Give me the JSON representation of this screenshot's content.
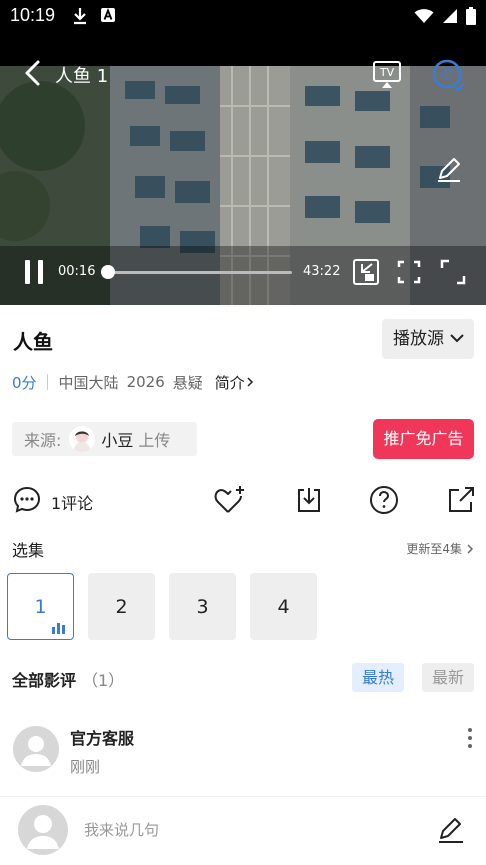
{
  "status_bar": {
    "time": "10:19"
  },
  "player": {
    "title": "人鱼 1",
    "tv_label": "TV",
    "speed_label": "倍",
    "current_time": "00:16",
    "total_time": "43:22",
    "progress": 0.006
  },
  "show": {
    "title": "人鱼",
    "source_label": "播放源",
    "score": "0分",
    "region": "中国大陆",
    "year": "2026",
    "genre": "悬疑",
    "intro_label": "简介"
  },
  "uploader": {
    "prefix": "来源:",
    "name": "小豆",
    "suffix": "上传"
  },
  "promo_label": "推广免广告",
  "actions": {
    "comment_count": "1评论"
  },
  "episodes": {
    "title": "选集",
    "update_text": "更新至4集",
    "items": [
      {
        "label": "1",
        "active": true
      },
      {
        "label": "2",
        "active": false
      },
      {
        "label": "3",
        "active": false
      },
      {
        "label": "4",
        "active": false
      }
    ]
  },
  "reviews": {
    "title": "全部影评",
    "count": "（1）",
    "sort_hot": "最热",
    "sort_new": "最新",
    "items": [
      {
        "name": "官方客服",
        "time": "刚刚"
      }
    ]
  },
  "comment_box": {
    "placeholder": "我来说几句"
  },
  "colors": {
    "accent": "#3a7bd5",
    "promo": "#f0375a"
  }
}
